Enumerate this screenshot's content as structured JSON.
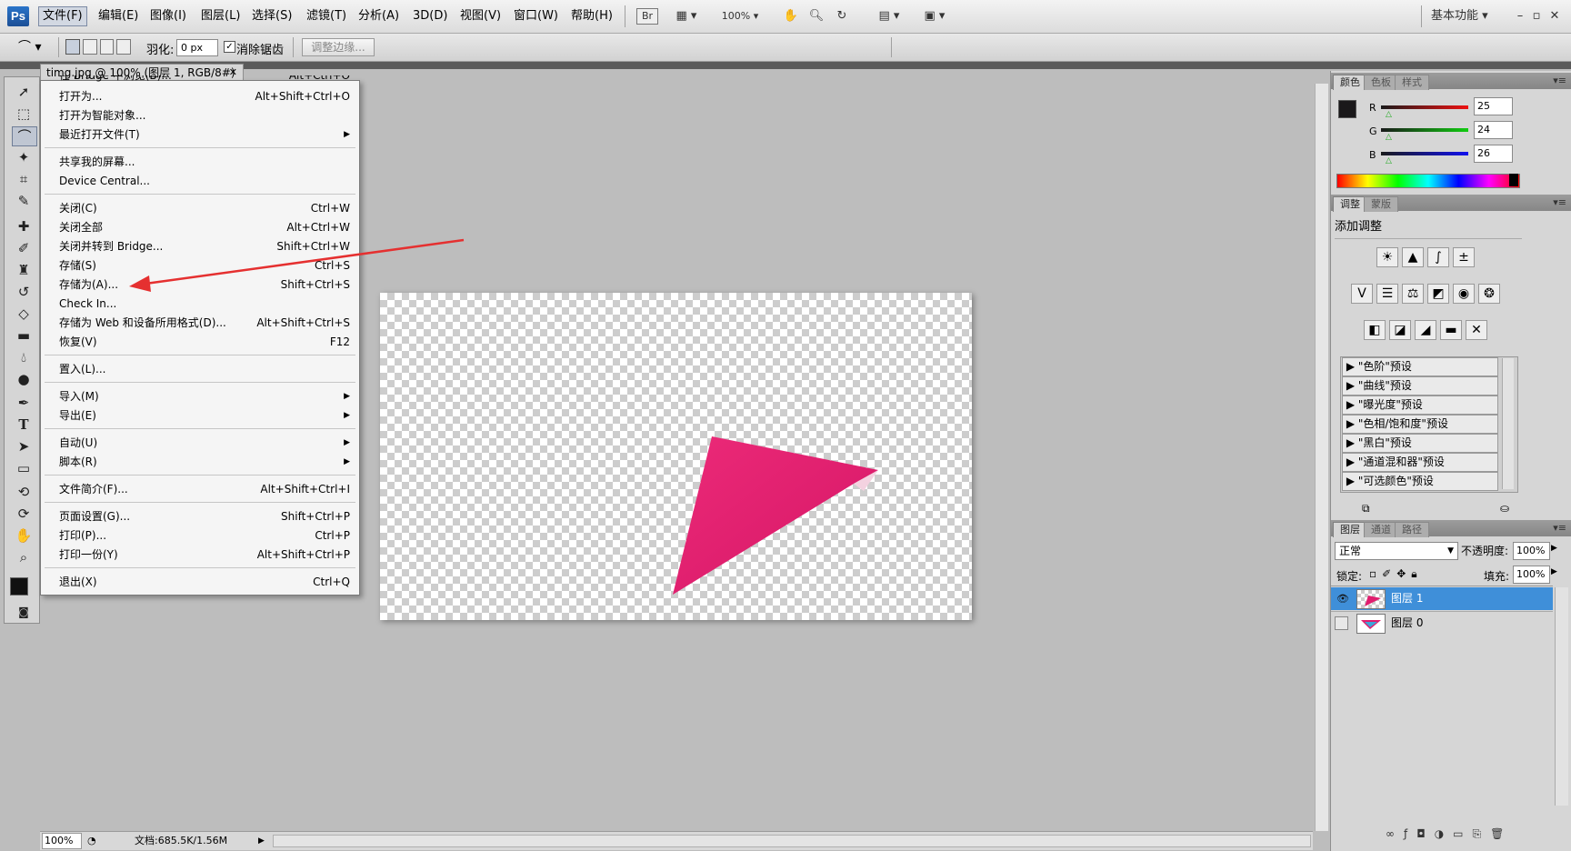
{
  "menubar": {
    "logo": "Ps",
    "items": [
      "文件(F)",
      "编辑(E)",
      "图像(I)",
      "图层(L)",
      "选择(S)",
      "滤镜(T)",
      "分析(A)",
      "3D(D)",
      "视图(V)",
      "窗口(W)",
      "帮助(H)"
    ],
    "bridge_label": "Br",
    "zoom": "100%",
    "workspace": "基本功能"
  },
  "options_bar": {
    "feather_label": "羽化:",
    "feather_value": "0 px",
    "antialias_label": "消除锯齿",
    "refine_edge_label": "调整边缘..."
  },
  "document": {
    "tab_title": "timg.jpg @ 100% (图层 1, RGB/8#) *"
  },
  "file_menu": {
    "partial_top": "在 Bridge 中浏览(B)...",
    "partial_top_shortcut": "Alt+Ctrl+O",
    "groups": [
      [
        {
          "label": "打开为...",
          "shortcut": "Alt+Shift+Ctrl+O"
        },
        {
          "label": "打开为智能对象...",
          "shortcut": ""
        },
        {
          "label": "最近打开文件(T)",
          "shortcut": "",
          "submenu": true
        }
      ],
      [
        {
          "label": "共享我的屏幕...",
          "shortcut": ""
        },
        {
          "label": "Device Central...",
          "shortcut": ""
        }
      ],
      [
        {
          "label": "关闭(C)",
          "shortcut": "Ctrl+W"
        },
        {
          "label": "关闭全部",
          "shortcut": "Alt+Ctrl+W"
        },
        {
          "label": "关闭并转到 Bridge...",
          "shortcut": "Shift+Ctrl+W"
        },
        {
          "label": "存储(S)",
          "shortcut": "Ctrl+S"
        },
        {
          "label": "存储为(A)...",
          "shortcut": "Shift+Ctrl+S"
        },
        {
          "label": "Check In...",
          "shortcut": ""
        },
        {
          "label": "存储为 Web 和设备所用格式(D)...",
          "shortcut": "Alt+Shift+Ctrl+S"
        },
        {
          "label": "恢复(V)",
          "shortcut": "F12"
        }
      ],
      [
        {
          "label": "置入(L)...",
          "shortcut": ""
        }
      ],
      [
        {
          "label": "导入(M)",
          "shortcut": "",
          "submenu": true
        },
        {
          "label": "导出(E)",
          "shortcut": "",
          "submenu": true
        }
      ],
      [
        {
          "label": "自动(U)",
          "shortcut": "",
          "submenu": true
        },
        {
          "label": "脚本(R)",
          "shortcut": "",
          "submenu": true
        }
      ],
      [
        {
          "label": "文件简介(F)...",
          "shortcut": "Alt+Shift+Ctrl+I"
        }
      ],
      [
        {
          "label": "页面设置(G)...",
          "shortcut": "Shift+Ctrl+P"
        },
        {
          "label": "打印(P)...",
          "shortcut": "Ctrl+P"
        },
        {
          "label": "打印一份(Y)",
          "shortcut": "Alt+Shift+Ctrl+P"
        }
      ],
      [
        {
          "label": "退出(X)",
          "shortcut": "Ctrl+Q"
        }
      ]
    ]
  },
  "status_bar": {
    "zoom": "100%",
    "doc_info": "文档:685.5K/1.56M"
  },
  "color_panel": {
    "tabs": [
      "颜色",
      "色板",
      "样式"
    ],
    "r_label": "R",
    "r_value": "25",
    "g_label": "G",
    "g_value": "24",
    "b_label": "B",
    "b_value": "26"
  },
  "adjust_panel": {
    "tabs": [
      "调整",
      "蒙版"
    ],
    "title": "添加调整",
    "presets": [
      "\"色阶\"预设",
      "\"曲线\"预设",
      "\"曝光度\"预设",
      "\"色相/饱和度\"预设",
      "\"黑白\"预设",
      "\"通道混和器\"预设",
      "\"可选颜色\"预设"
    ]
  },
  "layers_panel": {
    "tabs": [
      "图层",
      "通道",
      "路径"
    ],
    "blend_mode": "正常",
    "opacity_label": "不透明度:",
    "opacity_value": "100%",
    "lock_label": "锁定:",
    "fill_label": "填充:",
    "fill_value": "100%",
    "layers": [
      {
        "name": "图层 1",
        "selected": true,
        "visible": true
      },
      {
        "name": "图层 0",
        "selected": false,
        "visible": false
      }
    ]
  },
  "colors": {
    "triangle": "#e01e6e",
    "arrow": "#e53030",
    "selection_blue": "#3f8fd9"
  }
}
